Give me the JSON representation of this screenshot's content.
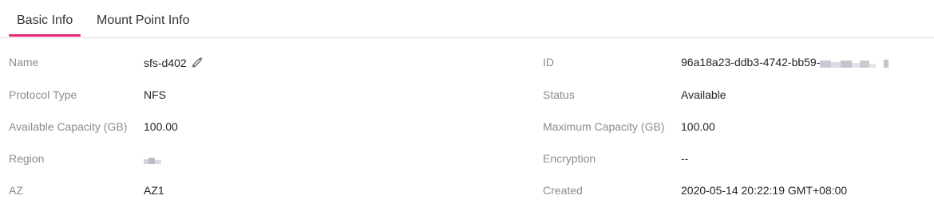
{
  "tabs": {
    "basic_info": "Basic Info",
    "mount_point_info": "Mount Point Info",
    "active_color": "#e32674"
  },
  "left": {
    "name_label": "Name",
    "name_value": "sfs-d402",
    "protocol_label": "Protocol Type",
    "protocol_value": "NFS",
    "available_label": "Available Capacity (GB)",
    "available_value": "100.00",
    "region_label": "Region",
    "region_value": "",
    "az_label": "AZ",
    "az_value": "AZ1"
  },
  "right": {
    "id_label": "ID",
    "id_value": "96a18a23-ddb3-4742-bb59-",
    "status_label": "Status",
    "status_value": "Available",
    "max_label": "Maximum Capacity (GB)",
    "max_value": "100.00",
    "encryption_label": "Encryption",
    "encryption_value": "--",
    "created_label": "Created",
    "created_value": "2020-05-14 20:22:19 GMT+08:00"
  },
  "icons": {
    "edit": "pencil-icon"
  }
}
